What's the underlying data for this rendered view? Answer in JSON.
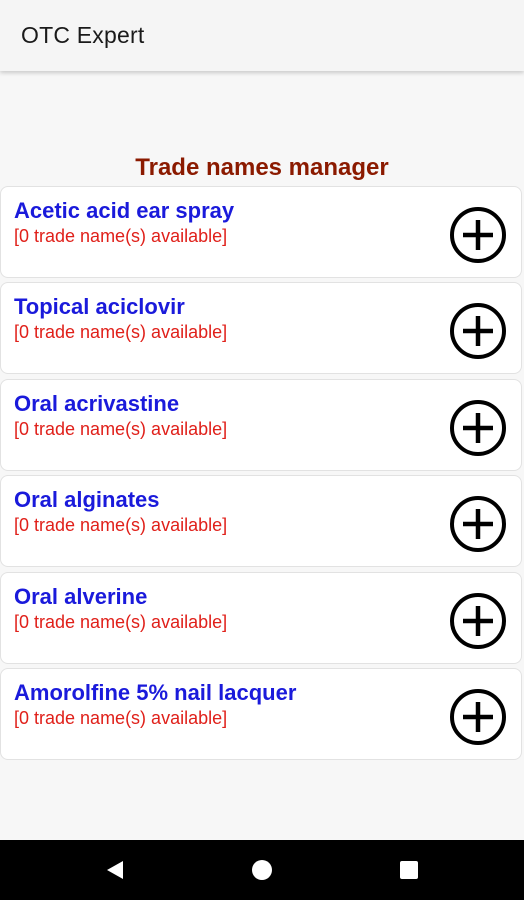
{
  "app_bar": {
    "title": "OTC Expert"
  },
  "main": {
    "section_title": "Trade names manager",
    "items": [
      {
        "name": "Acetic acid ear spray",
        "status": "[0 trade name(s) available]"
      },
      {
        "name": "Topical aciclovir",
        "status": "[0 trade name(s) available]"
      },
      {
        "name": "Oral acrivastine",
        "status": "[0 trade name(s) available]"
      },
      {
        "name": "Oral alginates",
        "status": "[0 trade name(s) available]"
      },
      {
        "name": "Oral alverine",
        "status": "[0 trade name(s) available]"
      },
      {
        "name": "Amorolfine 5% nail lacquer",
        "status": "[0 trade name(s) available]"
      }
    ]
  },
  "colors": {
    "item_title": "#1a1adb",
    "item_status": "#e0201a",
    "section_title": "#8b1a00",
    "nav_bar": "#000000"
  },
  "icons": {
    "add": "plus-circle-icon",
    "nav_back": "back-triangle-icon",
    "nav_home": "home-circle-icon",
    "nav_recents": "recents-square-icon"
  }
}
